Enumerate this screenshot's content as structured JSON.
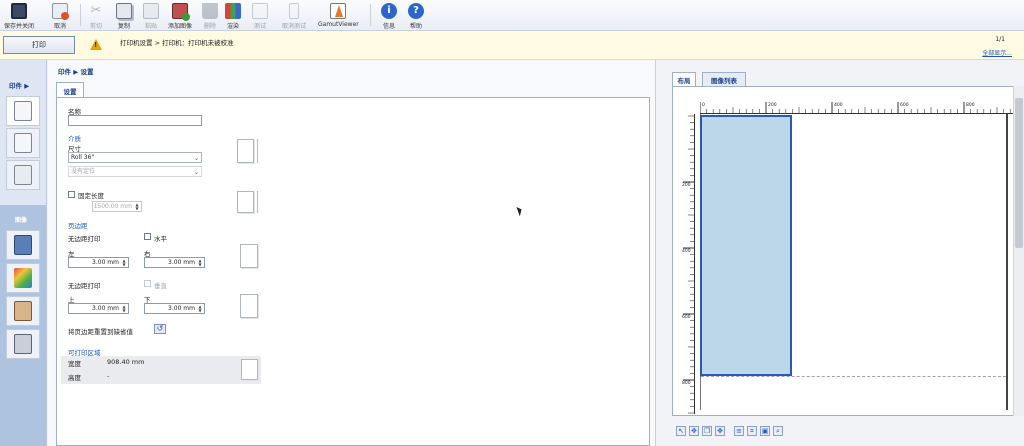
{
  "toolbar": {
    "items": [
      {
        "label": "保存并关闭",
        "icon": "save-close-icon",
        "enabled": true
      },
      {
        "label": "取消",
        "icon": "cancel-icon",
        "enabled": true
      },
      {
        "label": "剪切",
        "icon": "cut-icon",
        "enabled": false
      },
      {
        "label": "复制",
        "icon": "copy-icon",
        "enabled": true
      },
      {
        "label": "粘贴",
        "icon": "paste-icon",
        "enabled": false
      },
      {
        "label": "添加图像",
        "icon": "add-image-icon",
        "enabled": true
      },
      {
        "label": "删除",
        "icon": "delete-icon",
        "enabled": false
      },
      {
        "label": "渲染",
        "icon": "render-icon",
        "enabled": true
      },
      {
        "label": "测试",
        "icon": "test-icon",
        "enabled": false
      },
      {
        "label": "取消测试",
        "icon": "cancel-test-icon",
        "enabled": false
      },
      {
        "label": "GamutViewer",
        "icon": "gamut-viewer-icon",
        "enabled": true
      },
      {
        "label": "信息",
        "icon": "info-icon",
        "enabled": true
      },
      {
        "label": "帮助",
        "icon": "help-icon",
        "enabled": true
      }
    ]
  },
  "message_bar": {
    "print_button": "打印",
    "text": "打印机设置 > 打印机：打印机未被校准",
    "page_count": "1/1",
    "show_all_link": "全部显示..."
  },
  "left_nav": {
    "print_section": "印件 ▶",
    "image_section": "图像"
  },
  "settings": {
    "breadcrumb": "印件  ▶  设置",
    "tab": "设置",
    "name_label": "名称",
    "name_value": "",
    "media_section": "介质",
    "size_label": "尺寸",
    "size_value": "Roll 36\"",
    "positioning_value": "没有定位",
    "fixed_length_label": "固定长度",
    "fixed_length_value": "1500.00 mm",
    "margins_section": "页边距",
    "borderless_label_1": "无边距打印",
    "horizontal_label": "水平",
    "left_label": "左",
    "left_value": "3.00 mm",
    "right_label": "右",
    "right_value": "3.00 mm",
    "borderless_label_2": "无边距打印",
    "vertical_label": "垂直",
    "top_label": "上",
    "top_value": "3.00 mm",
    "bottom_label": "下",
    "bottom_value": "3.00 mm",
    "reset_label": "将页边距重置到缺省值",
    "printable_section": "可打印区域",
    "width_label": "宽度",
    "width_value": "908.40 mm",
    "height_label": "高度",
    "height_value": "-"
  },
  "preview": {
    "tab_layout": "布局",
    "tab_image_list": "图像列表",
    "ruler_h_labels": [
      "0",
      "200",
      "400",
      "600",
      "800"
    ],
    "ruler_v_labels": [
      "200",
      "400",
      "600",
      "800"
    ]
  },
  "colors": {
    "accent": "#1d3f8a",
    "link": "#1a56c4",
    "sheet_fill": "#bcd6ea",
    "sheet_border": "#2b57b8",
    "warning": "#e6a400"
  }
}
